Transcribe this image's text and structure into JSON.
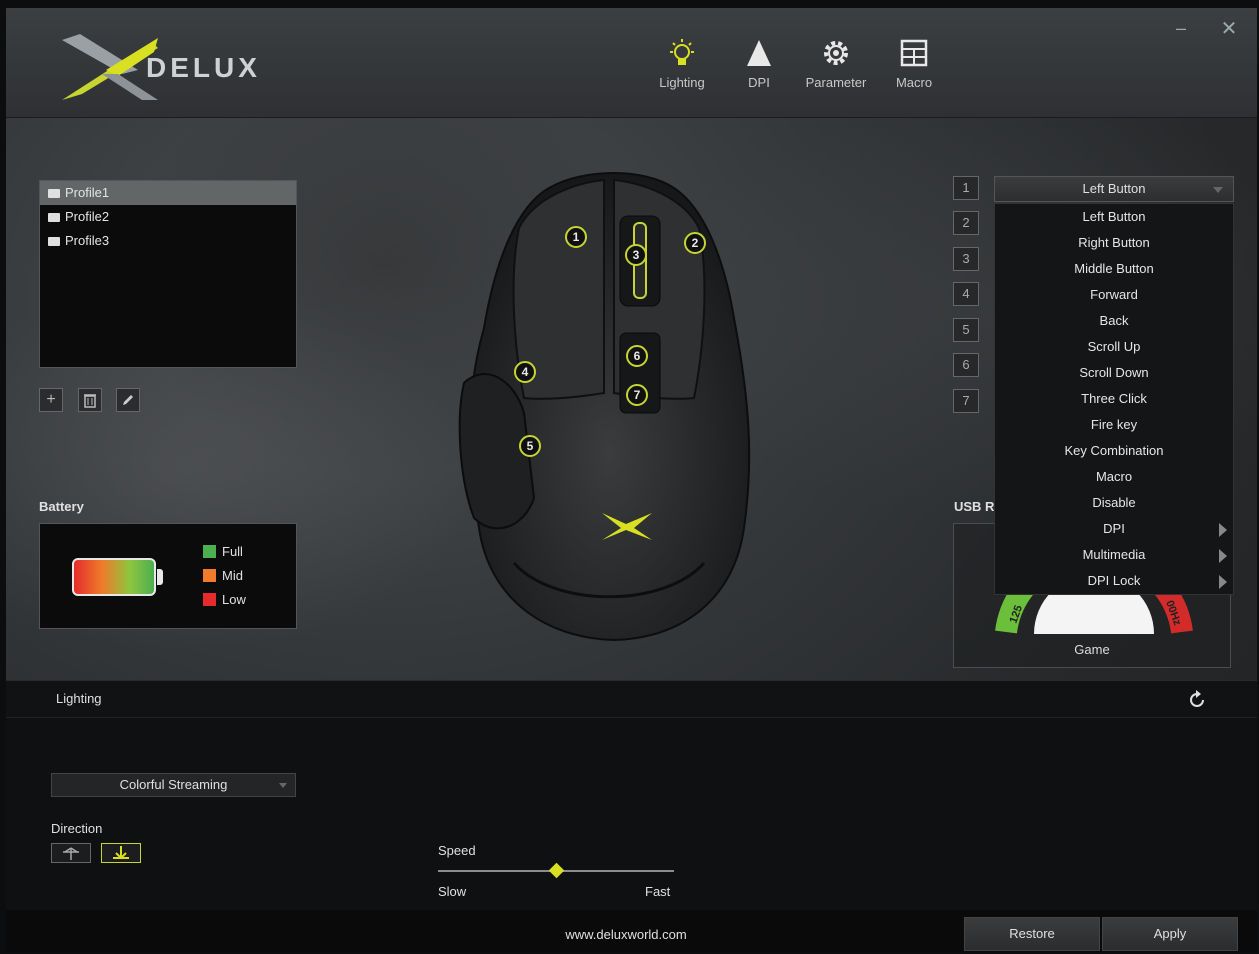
{
  "app": {
    "brand": "DELUX",
    "window_controls": {
      "minimize": "–",
      "close": "✕"
    }
  },
  "nav": [
    {
      "label": "Lighting",
      "icon": "bulb-icon",
      "active": true
    },
    {
      "label": "DPI",
      "icon": "arrow-up-icon"
    },
    {
      "label": "Parameter",
      "icon": "gear-icon"
    },
    {
      "label": "Macro",
      "icon": "grid-icon"
    }
  ],
  "profiles": {
    "items": [
      "Profile1",
      "Profile2",
      "Profile3"
    ],
    "selected_index": 0,
    "actions": {
      "add": "+",
      "delete": "🗑",
      "edit": "✎"
    }
  },
  "battery": {
    "label": "Battery",
    "legend": [
      {
        "label": "Full",
        "color": "#4caf50"
      },
      {
        "label": "Mid",
        "color": "#f07b2a"
      },
      {
        "label": "Low",
        "color": "#e52c2c"
      }
    ]
  },
  "mouse": {
    "buttons": [
      "1",
      "2",
      "3",
      "4",
      "5",
      "6",
      "7"
    ]
  },
  "button_assign": {
    "row_numbers": [
      "1",
      "2",
      "3",
      "4",
      "5",
      "6",
      "7"
    ],
    "selected": "Left Button",
    "menu": [
      {
        "label": "Left Button"
      },
      {
        "label": "Right Button"
      },
      {
        "label": "Middle Button"
      },
      {
        "label": "Forward"
      },
      {
        "label": "Back"
      },
      {
        "label": "Scroll Up"
      },
      {
        "label": "Scroll Down"
      },
      {
        "label": "Three Click"
      },
      {
        "label": "Fire key"
      },
      {
        "label": "Key Combination"
      },
      {
        "label": "Macro"
      },
      {
        "label": "Disable"
      },
      {
        "label": "DPI",
        "submenu": true
      },
      {
        "label": "Multimedia",
        "submenu": true
      },
      {
        "label": "DPI Lock",
        "submenu": true
      }
    ]
  },
  "usb": {
    "label": "USB R",
    "gauge_left": "125",
    "gauge_right": "00Hz",
    "mode": "Game"
  },
  "lighting": {
    "title": "Lighting",
    "mode": "Colorful Streaming",
    "direction_label": "Direction",
    "direction_up": "↑",
    "direction_down": "↓",
    "speed_label": "Speed",
    "speed_value": 0.5,
    "slow": "Slow",
    "fast": "Fast"
  },
  "footer": {
    "website": "www.deluxworld.com",
    "restore": "Restore",
    "apply": "Apply"
  }
}
